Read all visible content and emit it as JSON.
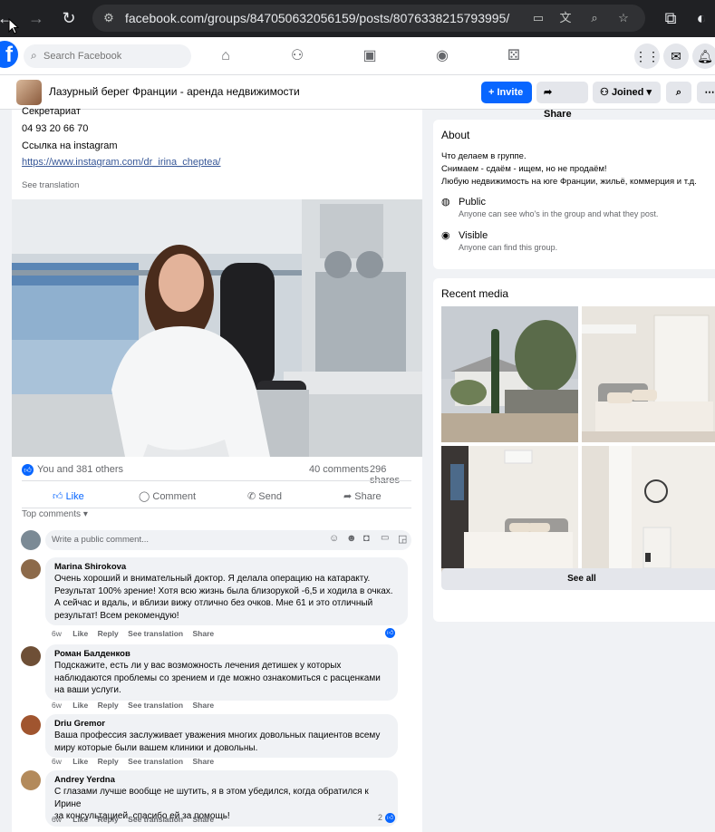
{
  "browser": {
    "url": "facebook.com/groups/847050632056159/posts/8076338215793995/"
  },
  "fb": {
    "search_placeholder": "Search Facebook"
  },
  "group": {
    "name": "Лазурный берег Франции - аренда недвижимости",
    "invite_label": "Invite",
    "share_label": "Share",
    "joined_label": "Joined"
  },
  "post": {
    "partial_top_text": "Секретариат",
    "phone": "04 93 20 66 70",
    "instagram_label": "Ссылка на instagram",
    "instagram_url": "https://www.instagram.com/dr_irina_cheptea/",
    "see_translation": "See translation",
    "reactions": "You and 381 others",
    "comments_count": "40 comments",
    "shares_count": "296 shares",
    "actions": {
      "like": "Like",
      "comment": "Comment",
      "send": "Send",
      "share": "Share"
    },
    "sort_label": "Top comments",
    "comment_placeholder": "Write a public comment..."
  },
  "comments": [
    {
      "author": "Marina Shirokova",
      "lines": [
        "Очень хороший и внимательный доктор. Я делала операцию на катаракту.",
        "Результат 100% зрение! Хотя всю жизнь была близорукой -6,5 и ходила в очках.",
        "А сейчас и вдаль, и вблизи вижу отлично без очков. Мне 61 и это отличный",
        "результат! Всем рекомендую!"
      ],
      "age": "6w",
      "like": "Like",
      "reply": "Reply",
      "translate": "See translation",
      "share": "Share",
      "reaction_count": ""
    },
    {
      "author": "Роман Балденков",
      "lines": [
        "Подскажите, есть ли у вас возможность лечения детишек у которых",
        "наблюдаются проблемы со зрением и где можно ознакомиться с расценками",
        "на ваши услуги."
      ],
      "age": "6w",
      "like": "Like",
      "reply": "Reply",
      "translate": "See translation",
      "share": "Share",
      "reaction_count": ""
    },
    {
      "author": "Driu Gremor",
      "lines": [
        "Ваша профессия заслуживает уважения многих довольных пациентов всему",
        "миру которые были вашем клиники и довольны."
      ],
      "age": "6w",
      "like": "Like",
      "reply": "Reply",
      "translate": "See translation",
      "share": "Share",
      "reaction_count": ""
    },
    {
      "author": "Andrey Yerdna",
      "lines": [
        "С глазами лучше вообще не шутить, я в этом убедился, когда обратился к Ирине",
        "за консультацией, спасибо ей за помощь!"
      ],
      "age": "6w",
      "like": "Like",
      "reply": "Reply",
      "translate": "See translation",
      "share": "Share",
      "reaction_count": "2"
    }
  ],
  "about": {
    "title": "About",
    "desc": [
      "Что делаем в группе.",
      "Снимаем - сдаём - ищем, но не продаём!",
      "Любую недвижимость на юге Франции, жильё, коммерция и т.д."
    ],
    "public_title": "Public",
    "public_desc": "Anyone can see who's in the group and what they post.",
    "visible_title": "Visible",
    "visible_desc": "Anyone can find this group."
  },
  "recent_media": {
    "title": "Recent media",
    "see_all": "See all"
  },
  "colors": {
    "fb_blue": "#0866ff",
    "link": "#385898",
    "chrome_bg": "#202124"
  }
}
